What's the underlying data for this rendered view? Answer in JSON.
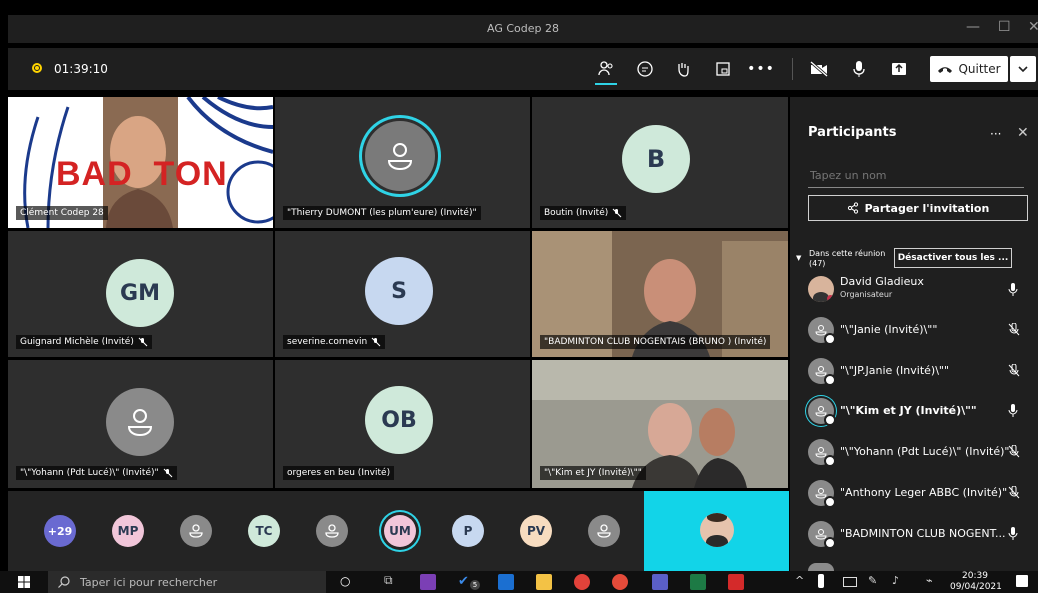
{
  "window": {
    "title": "AG Codep 28"
  },
  "toolbar": {
    "timer": "01:39:10",
    "leave_label": "Quitter"
  },
  "tiles": [
    {
      "name": "Clément Codep 28",
      "muted": false
    },
    {
      "name": "\"Thierry DUMONT (les plum'eure) (Invité)\"",
      "muted": false
    },
    {
      "name": "Boutin (Invité)",
      "initials": "B",
      "muted": true
    },
    {
      "name": "Guignard Michèle (Invité)",
      "initials": "GM",
      "muted": true
    },
    {
      "name": "severine.cornevin",
      "initials": "S",
      "muted": true
    },
    {
      "name": "\"BADMINTON CLUB NOGENTAIS (BRUNO ) (Invité)",
      "muted": false
    },
    {
      "name": "\"\\\"Yohann (Pdt Lucé)\\\" (Invité)\"",
      "muted": true
    },
    {
      "name": "orgeres en beu (Invité)",
      "initials": "OB",
      "muted": false
    },
    {
      "name": "\"\\\"Kim et JY (Invité)\\\"\"",
      "muted": false
    }
  ],
  "banner_text": "BAD  TON",
  "strip": {
    "overflow": "+29",
    "avatars": [
      "MP",
      "",
      "TC",
      "",
      "UM",
      "P",
      "PV",
      ""
    ]
  },
  "panel": {
    "title": "Participants",
    "search_placeholder": "Tapez un nom",
    "share_label": "Partager l'invitation",
    "section_label": "Dans cette réunion",
    "count": "(47)",
    "mute_all_label": "Désactiver tous les ...",
    "participants": [
      {
        "name": "David Gladieux",
        "role": "Organisateur",
        "muted": false
      },
      {
        "name": "\"\\\"Janie (Invité)\\\"\"",
        "muted": true
      },
      {
        "name": "\"\\\"JP.Janie (Invité)\\\"\"",
        "muted": true
      },
      {
        "name": "\"\\\"Kim et JY (Invité)\\\"\"",
        "muted": false,
        "speaking": true
      },
      {
        "name": "\"\\\"Yohann (Pdt Lucé)\\\" (Invité)\"",
        "muted": true
      },
      {
        "name": "\"Anthony Leger ABBC (Invité)\"",
        "muted": true
      },
      {
        "name": "\"BADMINTON CLUB NOGENT...",
        "muted": false
      }
    ]
  },
  "taskbar": {
    "search_placeholder": "Taper ici pour rechercher",
    "time": "20:39",
    "date": "09/04/2021",
    "mail_badge": "5"
  },
  "colors": {
    "accent": "#2fd3e6",
    "avatar_light": "#cfe9da",
    "avatar_blue": "#c7d8f0",
    "avatar_purple": "#6a6ad1",
    "avatar_pink": "#f1c6d9",
    "avatar_peach": "#f7dcc0"
  }
}
